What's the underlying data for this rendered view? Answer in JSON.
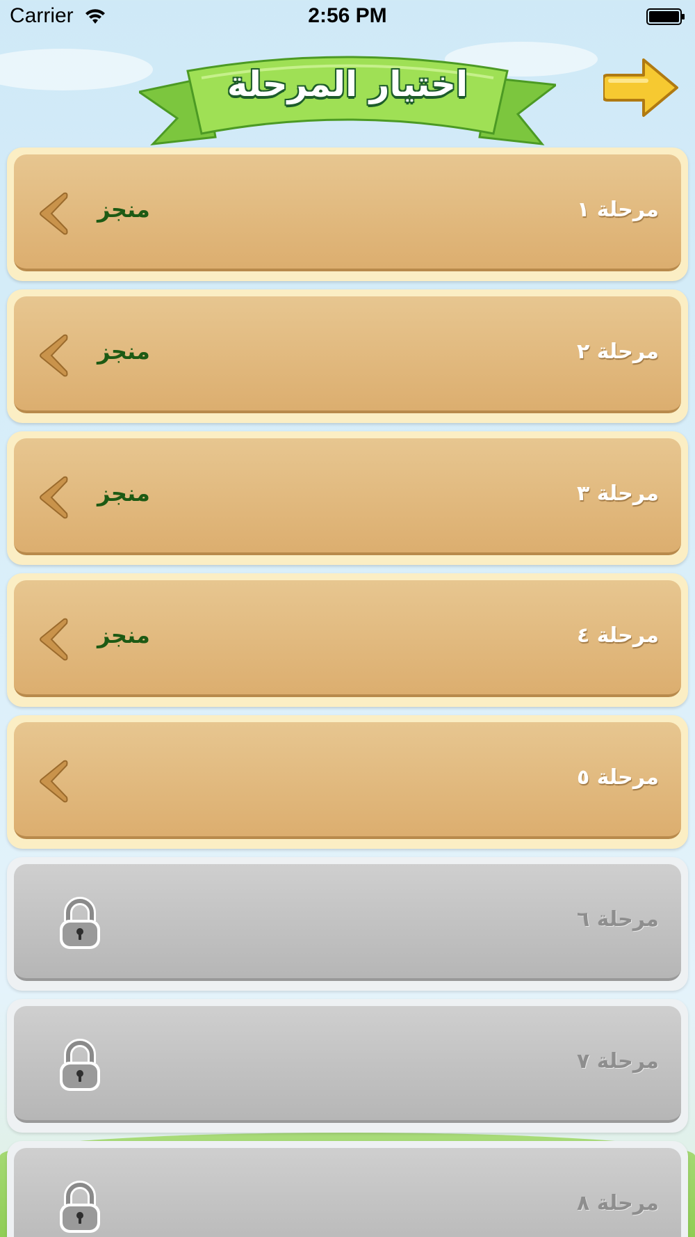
{
  "status_bar": {
    "carrier": "Carrier",
    "time": "2:56 PM"
  },
  "header": {
    "title": "اختيار المرحلة",
    "forward_icon": "arrow-right-icon"
  },
  "levels": [
    {
      "label": "مرحلة ١",
      "status": "منجز",
      "state": "completed",
      "icon": "chevron-left-icon"
    },
    {
      "label": "مرحلة ٢",
      "status": "منجز",
      "state": "completed",
      "icon": "chevron-left-icon"
    },
    {
      "label": "مرحلة ٣",
      "status": "منجز",
      "state": "completed",
      "icon": "chevron-left-icon"
    },
    {
      "label": "مرحلة ٤",
      "status": "منجز",
      "state": "completed",
      "icon": "chevron-left-icon"
    },
    {
      "label": "مرحلة ٥",
      "status": "",
      "state": "unlocked",
      "icon": "chevron-left-icon"
    },
    {
      "label": "مرحلة ٦",
      "status": "",
      "state": "locked",
      "icon": "lock-icon"
    },
    {
      "label": "مرحلة ٧",
      "status": "",
      "state": "locked",
      "icon": "lock-icon"
    },
    {
      "label": "مرحلة ٨",
      "status": "",
      "state": "locked",
      "icon": "lock-icon"
    }
  ],
  "colors": {
    "unlocked_row": "#dcae6f",
    "locked_row": "#b6b6b6",
    "done_text": "#1d5a14",
    "banner_green": "#8fd64b",
    "arrow_yellow": "#f6c931"
  }
}
